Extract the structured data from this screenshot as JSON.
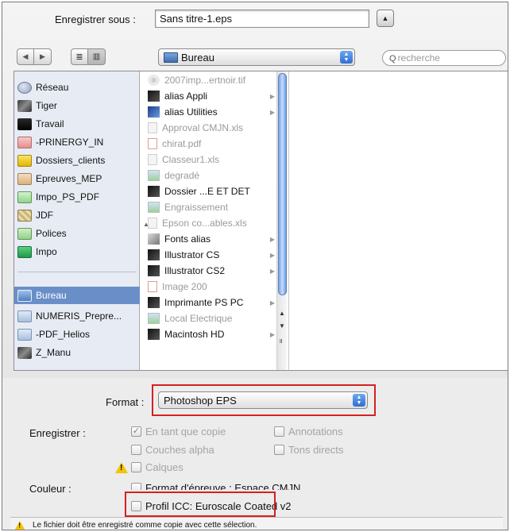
{
  "header": {
    "save_as_label": "Enregistrer sous :",
    "filename": "Sans titre-1.eps",
    "expand_icon": "triangle-up-icon"
  },
  "toolbar": {
    "back_icon": "back-arrow-icon",
    "forward_icon": "forward-arrow-icon",
    "list_view_icon": "list-view-icon",
    "column_view_icon": "column-view-icon",
    "location": "Bureau",
    "search_placeholder": "recherche"
  },
  "sidebar": {
    "items": [
      {
        "label": "Réseau",
        "icon": "network-icon"
      },
      {
        "label": "Tiger",
        "icon": "hard-drive-icon"
      },
      {
        "label": "Travail",
        "icon": "drive-icon"
      },
      {
        "label": "-PRINERGY_IN",
        "icon": "network-volume-icon"
      },
      {
        "label": "Dossiers_clients",
        "icon": "network-volume-icon"
      },
      {
        "label": "Epreuves_MEP",
        "icon": "network-volume-icon"
      },
      {
        "label": "Impo_PS_PDF",
        "icon": "network-volume-icon"
      },
      {
        "label": "JDF",
        "icon": "network-volume-icon"
      },
      {
        "label": "Polices",
        "icon": "network-volume-icon"
      },
      {
        "label": "Impo",
        "icon": "network-volume-icon"
      },
      {
        "label": "Bureau",
        "icon": "desktop-icon"
      },
      {
        "label": "NUMERIS_Prepre...",
        "icon": "folder-icon"
      },
      {
        "label": "-PDF_Helios",
        "icon": "folder-icon"
      },
      {
        "label": "Z_Manu",
        "icon": "hard-drive-icon"
      }
    ]
  },
  "files": [
    {
      "label": "2007imp...ertnoir.tif",
      "enabled": false,
      "folder": false,
      "icon": "image-file-icon"
    },
    {
      "label": "alias Appli",
      "enabled": true,
      "folder": true,
      "icon": "alias-icon"
    },
    {
      "label": "alias Utilities",
      "enabled": true,
      "folder": true,
      "icon": "alias-icon"
    },
    {
      "label": "Approval CMJN.xls",
      "enabled": false,
      "folder": false,
      "icon": "document-icon"
    },
    {
      "label": "chirat.pdf",
      "enabled": false,
      "folder": false,
      "icon": "pdf-file-icon"
    },
    {
      "label": "Classeur1.xls",
      "enabled": false,
      "folder": false,
      "icon": "document-icon"
    },
    {
      "label": "degradé",
      "enabled": false,
      "folder": false,
      "icon": "image-file-icon"
    },
    {
      "label": "Dossier ...E ET DET",
      "enabled": true,
      "folder": true,
      "icon": "folder-icon"
    },
    {
      "label": "Engraissement",
      "enabled": false,
      "folder": false,
      "icon": "image-file-icon"
    },
    {
      "label": "Epson co...ables.xls",
      "enabled": false,
      "folder": false,
      "icon": "document-icon"
    },
    {
      "label": "Fonts alias",
      "enabled": true,
      "folder": true,
      "icon": "alias-icon"
    },
    {
      "label": "Illustrator CS",
      "enabled": true,
      "folder": true,
      "icon": "folder-icon"
    },
    {
      "label": "Illustrator CS2",
      "enabled": true,
      "folder": true,
      "icon": "folder-icon"
    },
    {
      "label": "Image 200",
      "enabled": false,
      "folder": false,
      "icon": "pdf-file-icon"
    },
    {
      "label": "Imprimante PS PC",
      "enabled": true,
      "folder": true,
      "icon": "folder-icon"
    },
    {
      "label": "Local Electrique",
      "enabled": false,
      "folder": false,
      "icon": "image-file-icon"
    },
    {
      "label": "Macintosh HD",
      "enabled": true,
      "folder": true,
      "icon": "hard-drive-icon"
    }
  ],
  "format": {
    "label": "Format :",
    "value": "Photoshop EPS"
  },
  "save_options": {
    "label": "Enregistrer :",
    "as_copy": "En tant que copie",
    "annotations": "Annotations",
    "alpha_channels": "Couches alpha",
    "spot_colors": "Tons directs",
    "layers": "Calques"
  },
  "color_options": {
    "label": "Couleur :",
    "proof_setup": "Format d'épreuve : Espace CMJN",
    "icc_profile": "Profil ICC:  Euroscale Coated v2"
  },
  "notice": "Le fichier doit être enregistré comme copie avec cette sélection.",
  "colors": {
    "highlight": "#d62020",
    "selection": "#6a8fc8",
    "warning": "#f2c500"
  }
}
